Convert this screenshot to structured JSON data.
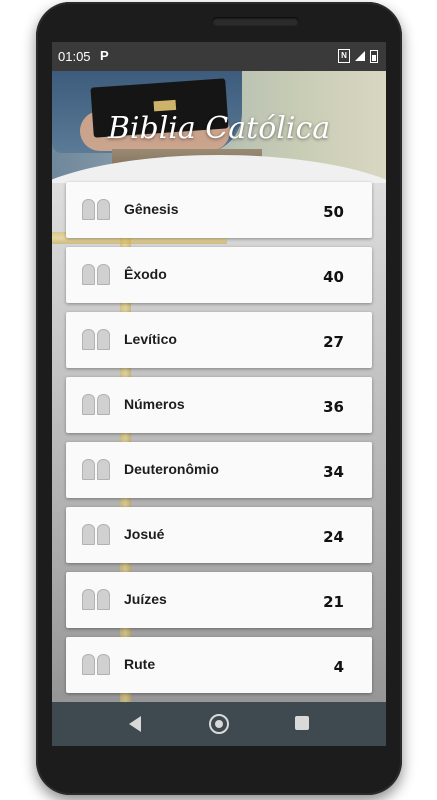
{
  "status": {
    "time": "01:05",
    "notification": "P"
  },
  "header": {
    "title": "Biblia Católica"
  },
  "books": [
    {
      "name": "Gênesis",
      "chapters": "50"
    },
    {
      "name": "Êxodo",
      "chapters": "40"
    },
    {
      "name": "Levítico",
      "chapters": "27"
    },
    {
      "name": "Números",
      "chapters": "36"
    },
    {
      "name": "Deuteronômio",
      "chapters": "34"
    },
    {
      "name": "Josué",
      "chapters": "24"
    },
    {
      "name": "Juízes",
      "chapters": "21"
    },
    {
      "name": "Rute",
      "chapters": "4"
    }
  ],
  "icons": {
    "book": "tablets-icon",
    "nav": [
      "back-icon",
      "home-icon",
      "recents-icon"
    ]
  }
}
